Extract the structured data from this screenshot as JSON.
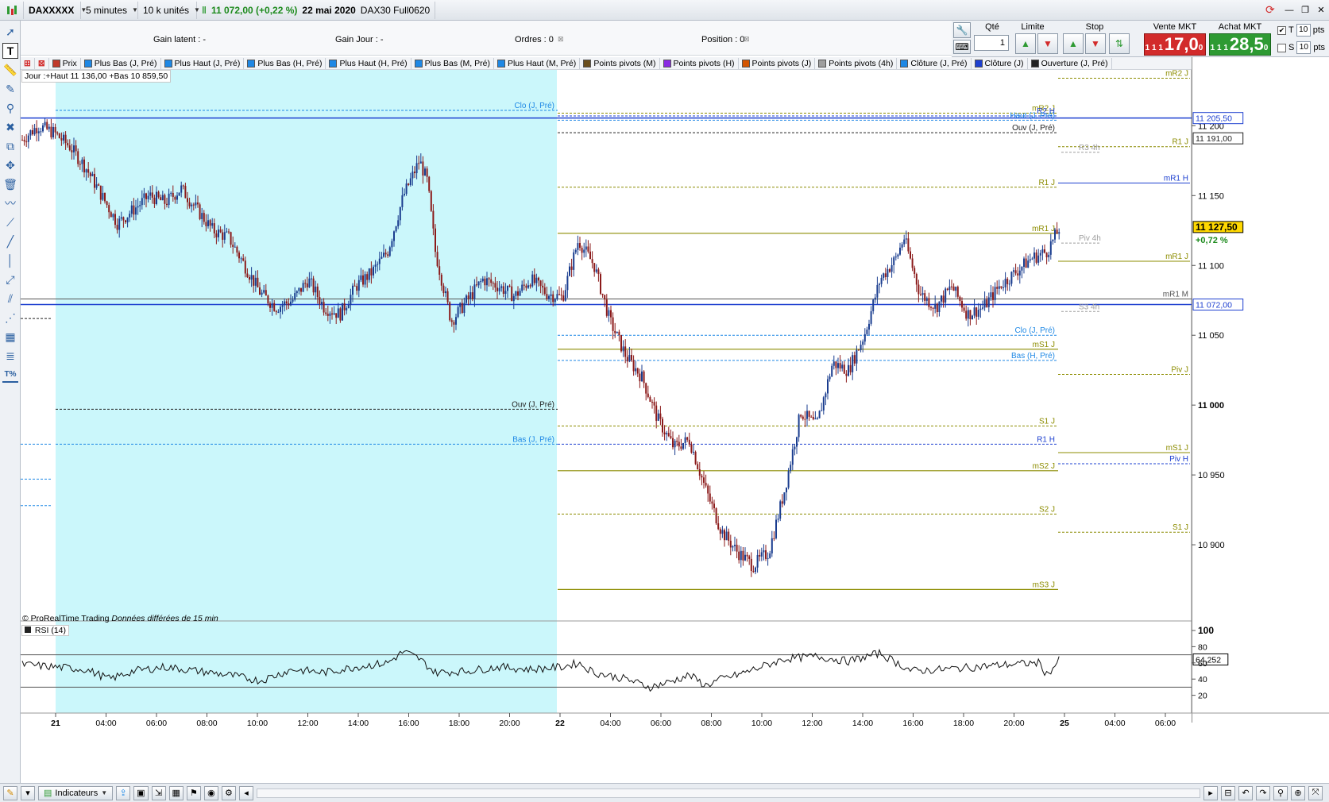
{
  "toolbar": {
    "instrument": "DAXXXXX",
    "timeframe": "5 minutes",
    "units": "10 k unités",
    "quote": "11 072,00 (+0,22 %)",
    "date": "22 mai 2020",
    "contract": "DAX30 Full0620"
  },
  "info": {
    "gain_latent": "Gain latent :  -",
    "gain_jour": "Gain Jour :  -",
    "ordres": "Ordres : 0",
    "position": "Position : 0"
  },
  "order_panel": {
    "qty_label": "Qté",
    "qty_value": "1",
    "limit_label": "Limite",
    "stop_label": "Stop",
    "sell_label": "Vente MKT",
    "buy_label": "Achat MKT",
    "sell_prefix": "1 1 1",
    "sell_price": "17,0",
    "sell_sup": "0",
    "buy_prefix": "1 1 1",
    "buy_price": "28,5",
    "buy_sup": "0",
    "t_label": "T",
    "s_label": "S",
    "pts1": "10",
    "pts2": "10",
    "pts_unit": "pts"
  },
  "legend": [
    {
      "label": "Prix",
      "color": "#c0392b"
    },
    {
      "label": "Plus Bas (J, Pré)",
      "color": "#1e88e5"
    },
    {
      "label": "Plus Haut (J, Pré)",
      "color": "#1e88e5"
    },
    {
      "label": "Plus Bas (H, Pré)",
      "color": "#1e88e5"
    },
    {
      "label": "Plus Haut (H, Pré)",
      "color": "#1e88e5"
    },
    {
      "label": "Plus Bas (M, Pré)",
      "color": "#1e88e5"
    },
    {
      "label": "Plus Haut (M, Pré)",
      "color": "#1e88e5"
    },
    {
      "label": "Points pivots (M)",
      "color": "#6b4f1d"
    },
    {
      "label": "Points pivots (H)",
      "color": "#8a2be2"
    },
    {
      "label": "Points pivots (J)",
      "color": "#d35400"
    },
    {
      "label": "Points pivots (4h)",
      "color": "#9e9e9e"
    },
    {
      "label": "Clôture (J, Pré)",
      "color": "#1e88e5"
    },
    {
      "label": "Clôture (J)",
      "color": "#1e40d0"
    },
    {
      "label": "Ouverture (J, Pré)",
      "color": "#222222"
    }
  ],
  "chart_header": "Jour :+Haut 11 136,00 +Bas 10 859,50",
  "copyright": "© ProRealTime Trading",
  "copyright_note": "Données différées de 15 min",
  "rsi_label": "RSI (14)",
  "bottom": {
    "indicators": "Indicateurs"
  },
  "colors": {
    "session_bg": "#cbf7fb",
    "up_candle": "#1a3d8f",
    "down_candle": "#8b1a1a",
    "olive": "#8c8c00",
    "blue": "#1e40d0",
    "light_blue": "#1e88e5"
  },
  "chart_data": {
    "type": "candlestick",
    "price_axis": {
      "ticks": [
        "11 200",
        "11 150",
        "11 100",
        "11 050",
        "11 000",
        "10 950",
        "10 900"
      ],
      "range": [
        10850,
        11240
      ]
    },
    "rsi_axis": {
      "ticks": [
        "100",
        "80",
        "60",
        "40",
        "20"
      ],
      "range": [
        0,
        100
      ],
      "overbought": 70,
      "oversold": 30
    },
    "x_labels": [
      "21",
      "04:00",
      "06:00",
      "08:00",
      "10:00",
      "12:00",
      "14:00",
      "16:00",
      "18:00",
      "20:00",
      "22",
      "04:00",
      "06:00",
      "08:00",
      "10:00",
      "12:00",
      "14:00",
      "16:00",
      "18:00",
      "20:00",
      "25",
      "04:00",
      "06:00"
    ],
    "price_badges": [
      {
        "label": "11 205,50",
        "value": 11205.5,
        "color": "#1e40d0",
        "fill": "#ffffff"
      },
      {
        "label": "11 191,00",
        "value": 11191,
        "color": "#222222",
        "fill": "#ffffff"
      },
      {
        "label": "11 127,50",
        "value": 11127.5,
        "color": "#000000",
        "fill": "#ffd800"
      },
      {
        "label": "11 072,00",
        "value": 11072,
        "color": "#1e40d0",
        "fill": "#ffffff"
      },
      {
        "label": "64,252",
        "value": 64.252,
        "color": "#000000",
        "fill": "#ffffff",
        "pane": "rsi"
      }
    ],
    "change_badge": "+0,72 %",
    "levels_left": [
      {
        "label": "Clo (J, Pré)",
        "value": 11211,
        "color": "#1e88e5",
        "style": "dash"
      },
      {
        "label": "Ouv (J, Pré)",
        "value": 10997,
        "color": "#222222",
        "style": "dash"
      },
      {
        "label": "Bas (J, Pré)",
        "value": 10972,
        "color": "#1e88e5",
        "style": "dash"
      }
    ],
    "levels_right": [
      {
        "label": "mR2 J",
        "value": 11209,
        "color": "#8c8c00",
        "style": "dash"
      },
      {
        "label": "R2 H",
        "value": 11207,
        "color": "#1e40d0",
        "style": "dash"
      },
      {
        "label": "Haut (J, Pré)",
        "value": 11204,
        "color": "#1e88e5",
        "style": "dash"
      },
      {
        "label": "Ouv (J, Pré)",
        "value": 11195,
        "color": "#222222",
        "style": "dash"
      },
      {
        "label": "R1 J",
        "value": 11156,
        "color": "#8c8c00",
        "style": "dash"
      },
      {
        "label": "mR1 J",
        "value": 11123,
        "color": "#8c8c00",
        "style": "solid"
      },
      {
        "label": "Clo (J, Pré)",
        "value": 11050,
        "color": "#1e88e5",
        "style": "dash"
      },
      {
        "label": "mS1 J",
        "value": 11040,
        "color": "#8c8c00",
        "style": "solid"
      },
      {
        "label": "Bas (H, Pré)",
        "value": 11032,
        "color": "#1e88e5",
        "style": "dash"
      },
      {
        "label": "S1 J",
        "value": 10985,
        "color": "#8c8c00",
        "style": "dash"
      },
      {
        "label": "R1 H",
        "value": 10972,
        "color": "#1e40d0",
        "style": "dash"
      },
      {
        "label": "mS2 J",
        "value": 10953,
        "color": "#8c8c00",
        "style": "solid"
      },
      {
        "label": "S2 J",
        "value": 10922,
        "color": "#8c8c00",
        "style": "dash"
      },
      {
        "label": "mS3 J",
        "value": 10868,
        "color": "#8c8c00",
        "style": "solid"
      }
    ],
    "levels_far_right": [
      {
        "label": "mR2 J",
        "value": 11234,
        "color": "#8c8c00",
        "style": "dash"
      },
      {
        "label": "R1 J",
        "value": 11185,
        "color": "#8c8c00",
        "style": "dash"
      },
      {
        "label": "mR1 H",
        "value": 11159,
        "color": "#1e40d0",
        "style": "solid"
      },
      {
        "label": "mR1 J",
        "value": 11103,
        "color": "#8c8c00",
        "style": "solid"
      },
      {
        "label": "mR1 M",
        "value": 11076,
        "color": "#555555",
        "style": "solid"
      },
      {
        "label": "Piv J",
        "value": 11022,
        "color": "#8c8c00",
        "style": "dash"
      },
      {
        "label": "mS1 J",
        "value": 10966,
        "color": "#8c8c00",
        "style": "solid"
      },
      {
        "label": "Piv H",
        "value": 10958,
        "color": "#1e40d0",
        "style": "dash"
      },
      {
        "label": "S1 J",
        "value": 10909,
        "color": "#8c8c00",
        "style": "dash"
      }
    ],
    "levels_4h": [
      {
        "label": "R3 4h",
        "value": 11181
      },
      {
        "label": "Piv 4h",
        "value": 11116
      },
      {
        "label": "S3 4h",
        "value": 11067
      }
    ],
    "price_path": [
      [
        0,
        11190
      ],
      [
        20,
        11200
      ],
      [
        40,
        11195
      ],
      [
        60,
        11185
      ],
      [
        80,
        11170
      ],
      [
        100,
        11150
      ],
      [
        120,
        11130
      ],
      [
        140,
        11140
      ],
      [
        160,
        11150
      ],
      [
        180,
        11145
      ],
      [
        200,
        11155
      ],
      [
        220,
        11140
      ],
      [
        240,
        11125
      ],
      [
        260,
        11120
      ],
      [
        280,
        11100
      ],
      [
        300,
        11080
      ],
      [
        320,
        11070
      ],
      [
        340,
        11075
      ],
      [
        360,
        11090
      ],
      [
        380,
        11070
      ],
      [
        400,
        11065
      ],
      [
        420,
        11085
      ],
      [
        440,
        11095
      ],
      [
        460,
        11110
      ],
      [
        480,
        11150
      ],
      [
        500,
        11175
      ],
      [
        510,
        11160
      ],
      [
        520,
        11110
      ],
      [
        540,
        11060
      ],
      [
        560,
        11075
      ],
      [
        580,
        11090
      ],
      [
        600,
        11085
      ],
      [
        620,
        11078
      ],
      [
        640,
        11090
      ],
      [
        660,
        11080
      ],
      [
        680,
        11077
      ],
      [
        700,
        11118
      ],
      [
        720,
        11100
      ],
      [
        740,
        11060
      ],
      [
        760,
        11035
      ],
      [
        780,
        11020
      ],
      [
        800,
        10990
      ],
      [
        820,
        10970
      ],
      [
        840,
        10975
      ],
      [
        860,
        10940
      ],
      [
        880,
        10910
      ],
      [
        900,
        10895
      ],
      [
        920,
        10885
      ],
      [
        940,
        10895
      ],
      [
        960,
        10940
      ],
      [
        980,
        10995
      ],
      [
        1000,
        10985
      ],
      [
        1020,
        11030
      ],
      [
        1040,
        11025
      ],
      [
        1060,
        11050
      ],
      [
        1080,
        11090
      ],
      [
        1100,
        11105
      ],
      [
        1110,
        11120
      ],
      [
        1130,
        11080
      ],
      [
        1150,
        11070
      ],
      [
        1170,
        11085
      ],
      [
        1190,
        11065
      ],
      [
        1210,
        11070
      ],
      [
        1230,
        11085
      ],
      [
        1250,
        11095
      ],
      [
        1270,
        11105
      ],
      [
        1290,
        11110
      ],
      [
        1306,
        11127
      ]
    ],
    "rsi_path": [
      [
        0,
        58
      ],
      [
        40,
        55
      ],
      [
        80,
        52
      ],
      [
        110,
        40
      ],
      [
        140,
        50
      ],
      [
        180,
        55
      ],
      [
        220,
        50
      ],
      [
        260,
        45
      ],
      [
        300,
        38
      ],
      [
        340,
        52
      ],
      [
        380,
        48
      ],
      [
        420,
        55
      ],
      [
        460,
        60
      ],
      [
        480,
        74
      ],
      [
        500,
        65
      ],
      [
        520,
        48
      ],
      [
        560,
        50
      ],
      [
        600,
        55
      ],
      [
        640,
        52
      ],
      [
        680,
        55
      ],
      [
        700,
        60
      ],
      [
        720,
        48
      ],
      [
        760,
        40
      ],
      [
        790,
        30
      ],
      [
        810,
        35
      ],
      [
        840,
        45
      ],
      [
        860,
        32
      ],
      [
        880,
        40
      ],
      [
        900,
        45
      ],
      [
        930,
        55
      ],
      [
        960,
        65
      ],
      [
        1000,
        68
      ],
      [
        1040,
        62
      ],
      [
        1080,
        72
      ],
      [
        1090,
        66
      ],
      [
        1120,
        50
      ],
      [
        1160,
        52
      ],
      [
        1200,
        55
      ],
      [
        1240,
        58
      ],
      [
        1280,
        60
      ],
      [
        1290,
        45
      ],
      [
        1306,
        64
      ]
    ]
  }
}
